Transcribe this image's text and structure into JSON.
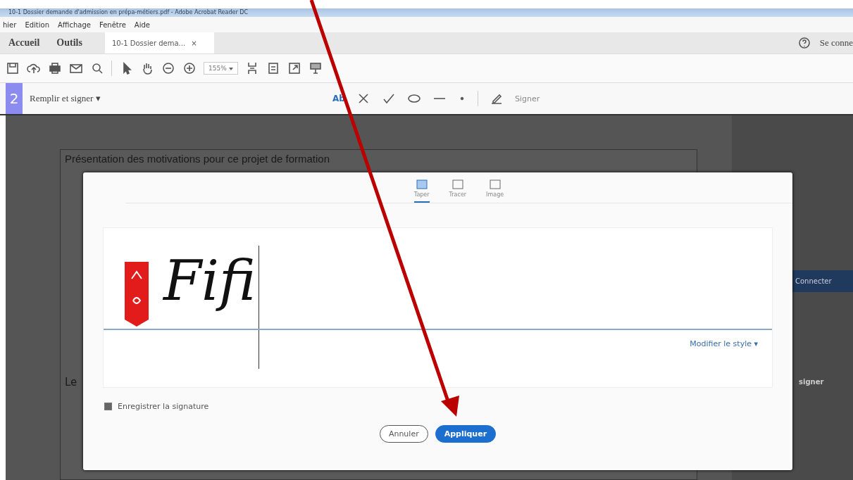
{
  "window": {
    "title": "10-1 Dossier demande d'admission en prépa-métiers.pdf - Adobe Acrobat Reader DC"
  },
  "menu": [
    "hier",
    "Edition",
    "Affichage",
    "Fenêtre",
    "Aide"
  ],
  "nav_tabs": [
    {
      "label": "Accueil",
      "selected": false
    },
    {
      "label": "Outils",
      "selected": false
    },
    {
      "label": "10-1 Dossier dema...",
      "selected": true
    }
  ],
  "tab_close": "×",
  "sign_in": "Se conne",
  "zoom_value": "155%",
  "fill_sign": {
    "step": "2",
    "title": "Remplir et signer ▾",
    "text_tool": "Ab",
    "sign": "Signer"
  },
  "document": {
    "heading": "Présentation des motivations pour ce projet de formation",
    "next_label": "Le"
  },
  "side_panel": {
    "button": "Connecter",
    "items": [
      "signer"
    ]
  },
  "dialog": {
    "modes": [
      {
        "label": "Taper",
        "selected": true
      },
      {
        "label": "Tracer",
        "selected": false
      },
      {
        "label": "Image",
        "selected": false
      }
    ],
    "signature": "Fifi",
    "style_link": "Modifier le style ▾",
    "save_signature": {
      "label": "Enregistrer la signature",
      "checked": true
    },
    "buttons": [
      {
        "label": "Annuler",
        "kind": "secondary"
      },
      {
        "label": "Appliquer",
        "kind": "primary"
      }
    ]
  }
}
